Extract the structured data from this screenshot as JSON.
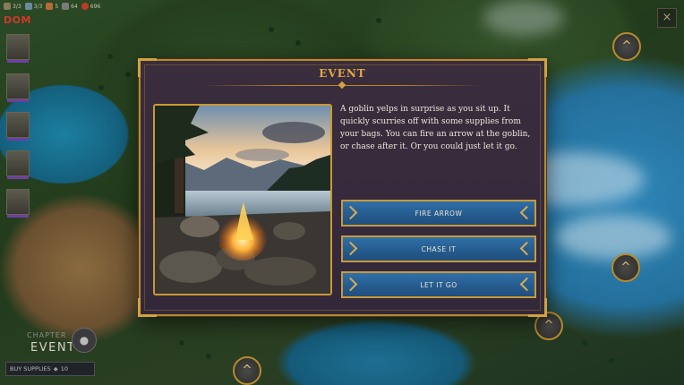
{
  "topbar": {
    "stats": [
      {
        "icon": "party-icon",
        "value": "3/3"
      },
      {
        "icon": "scroll-icon",
        "value": "3/3"
      },
      {
        "icon": "food-icon",
        "value": "5"
      },
      {
        "icon": "supplies-icon",
        "value": "64"
      },
      {
        "icon": "gold-icon",
        "value": "696"
      }
    ]
  },
  "hud": {
    "dom_label": "DOM",
    "chapter_label": "CHAPTER",
    "chapter_name": "EVENT",
    "buy_supplies_label": "BUY SUPPLIES",
    "buy_supplies_cost": "10",
    "close_glyph": "×",
    "node_glyph": "^",
    "chapter_glyph": "●"
  },
  "event": {
    "title": "EVENT",
    "story": "A goblin yelps in surprise as you sit up. It quickly scurries off with some supplies from your bags. You can fire an arrow at the goblin, or chase after it. Or you could just let it go.",
    "choices": [
      {
        "label": "FIRE ARROW"
      },
      {
        "label": "CHASE IT"
      },
      {
        "label": "LET IT GO"
      }
    ]
  },
  "colors": {
    "accent_gold": "#c79a3a",
    "title_gold": "#e2a941",
    "choice_blue": "#2f6fa8",
    "panel_purple": "#3a2d3d",
    "dom_red": "#d0392b",
    "hp_purple": "#6c3fa3"
  }
}
